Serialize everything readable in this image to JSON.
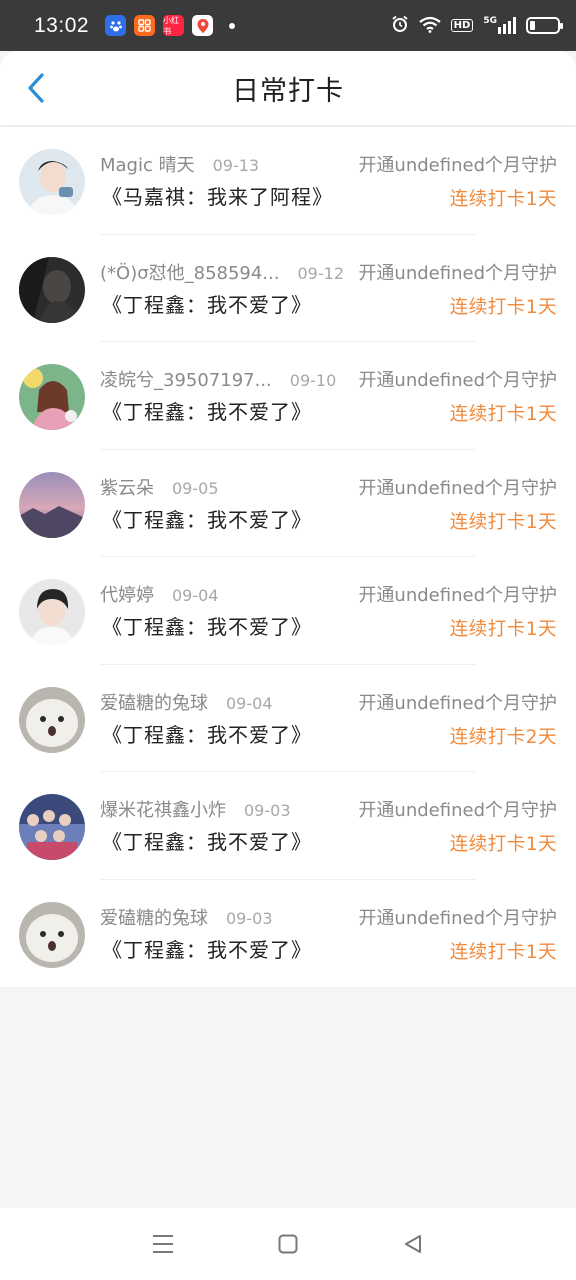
{
  "status_bar": {
    "time": "13:02",
    "app_icons": [
      "baidu-icon",
      "grid-app-icon",
      "xiaohongshu-icon",
      "map-pin-icon"
    ],
    "icons": [
      "alarm-icon",
      "wifi-icon",
      "hd-icon",
      "signal-5g-icon",
      "battery-icon"
    ],
    "hd_label": "HD",
    "network_label": "5G",
    "app_label_small": "小红书"
  },
  "header": {
    "title": "日常打卡",
    "back_icon": "chevron-left-icon",
    "accent_color": "#2b8fd6"
  },
  "records": [
    {
      "name": "Magic 晴天",
      "date": "09-13",
      "title": "《马嘉祺：我来了阿程》",
      "guard": "开通undefined个月守护",
      "streak": "连续打卡1天",
      "avatar": "boy-portrait"
    },
    {
      "name": "(*Ö)σ怼他_858594...",
      "date": "09-12",
      "title": "《丁程鑫：我不爱了》",
      "guard": "开通undefined个月守护",
      "streak": "连续打卡1天",
      "avatar": "dark-portrait"
    },
    {
      "name": "凌皖兮_39507197...",
      "date": "09-10",
      "title": "《丁程鑫：我不爱了》",
      "guard": "开通undefined个月守护",
      "streak": "连续打卡1天",
      "avatar": "anime-girl"
    },
    {
      "name": "紫云朵",
      "date": "09-05",
      "title": "《丁程鑫：我不爱了》",
      "guard": "开通undefined个月守护",
      "streak": "连续打卡1天",
      "avatar": "purple-sky"
    },
    {
      "name": "代婷婷",
      "date": "09-04",
      "title": "《丁程鑫：我不爱了》",
      "guard": "开通undefined个月守护",
      "streak": "连续打卡1天",
      "avatar": "boy-portrait"
    },
    {
      "name": "爱磕糖的兔球",
      "date": "09-04",
      "title": "《丁程鑫：我不爱了》",
      "guard": "开通undefined个月守护",
      "streak": "连续打卡2天",
      "avatar": "white-cat"
    },
    {
      "name": "爆米花祺鑫小炸",
      "date": "09-03",
      "title": "《丁程鑫：我不爱了》",
      "guard": "开通undefined个月守护",
      "streak": "连续打卡1天",
      "avatar": "group-photo"
    },
    {
      "name": "爱磕糖的兔球",
      "date": "09-03",
      "title": "《丁程鑫：我不爱了》",
      "guard": "开通undefined个月守护",
      "streak": "连续打卡1天",
      "avatar": "white-cat"
    }
  ],
  "colors": {
    "streak": "#f08a3c",
    "muted": "#8a8a8a",
    "background": "#f5f4f6"
  },
  "nav_bar": {
    "icons": [
      "menu-icon",
      "home-square-icon",
      "back-triangle-icon"
    ]
  }
}
